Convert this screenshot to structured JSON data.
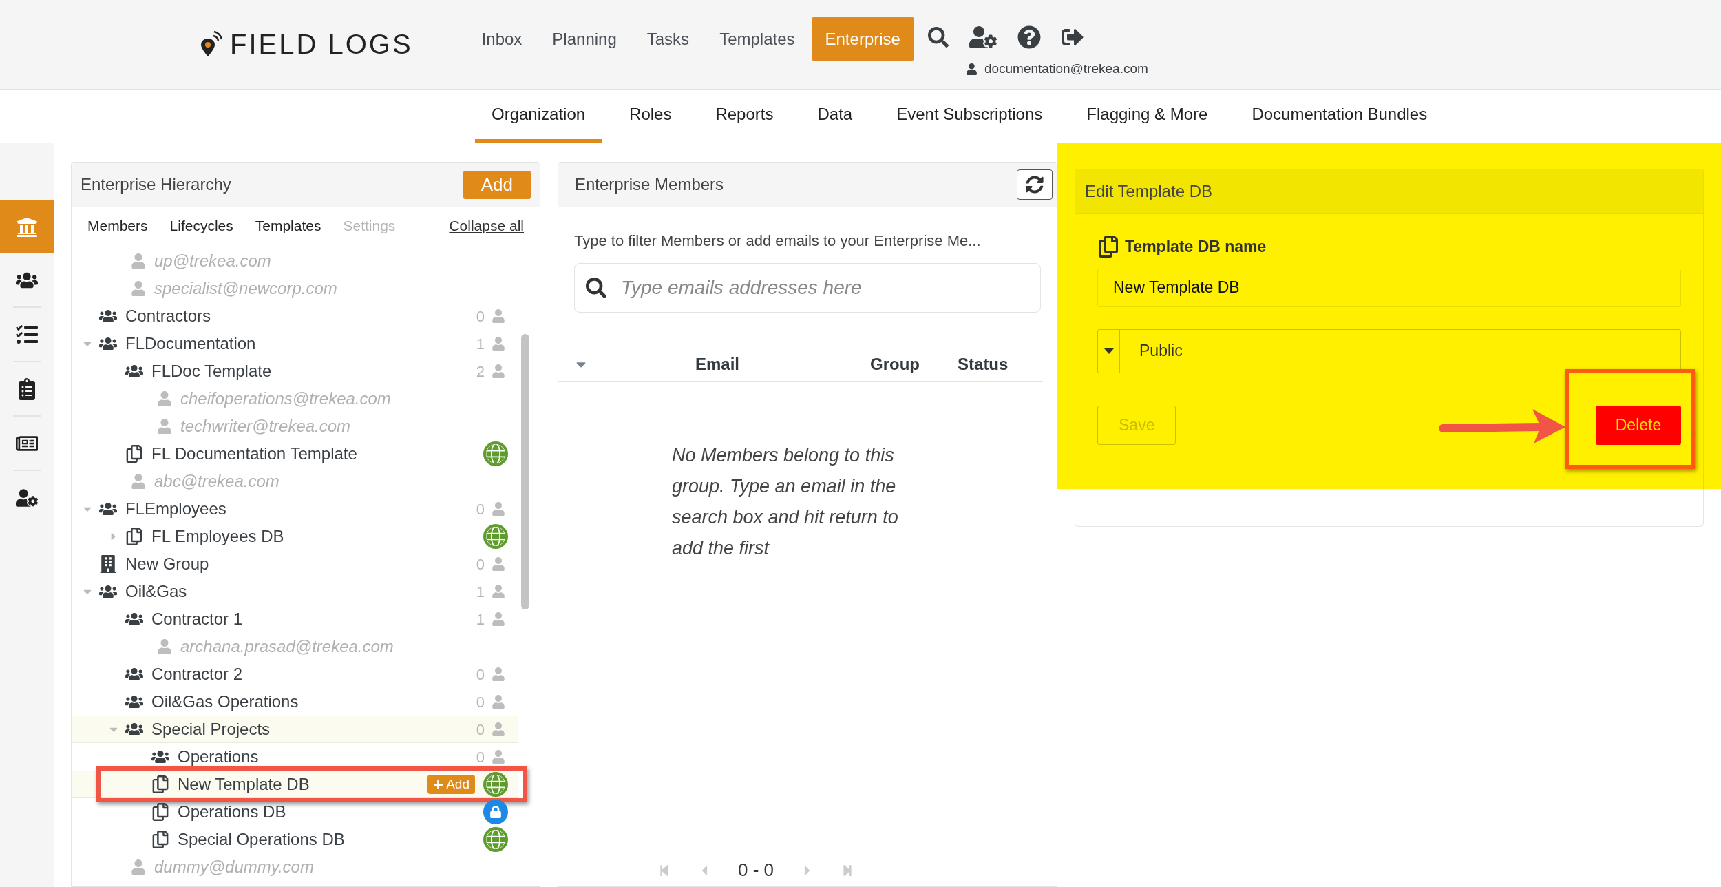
{
  "header": {
    "logo": "FIELD LOGS",
    "nav": [
      {
        "label": "Inbox",
        "selected": false
      },
      {
        "label": "Planning",
        "selected": false
      },
      {
        "label": "Tasks",
        "selected": false
      },
      {
        "label": "Templates",
        "selected": false
      },
      {
        "label": "Enterprise",
        "selected": true
      }
    ],
    "user": "documentation@trekea.com"
  },
  "subnav": [
    {
      "label": "Organization",
      "selected": true
    },
    {
      "label": "Roles",
      "selected": false
    },
    {
      "label": "Reports",
      "selected": false
    },
    {
      "label": "Data",
      "selected": false
    },
    {
      "label": "Event Subscriptions",
      "selected": false
    },
    {
      "label": "Flagging & More",
      "selected": false
    },
    {
      "label": "Documentation Bundles",
      "selected": false
    }
  ],
  "sidebar": [
    {
      "kind": "bank",
      "selected": true
    },
    {
      "kind": "users",
      "selected": false
    },
    {
      "kind": "tasks",
      "selected": false
    },
    {
      "kind": "clipboard",
      "selected": false
    },
    {
      "kind": "template",
      "selected": false
    },
    {
      "kind": "user-settings",
      "selected": false
    }
  ],
  "hierarchy": {
    "title": "Enterprise Hierarchy",
    "add": "Add",
    "tabs": [
      {
        "label": "Members",
        "disabled": false
      },
      {
        "label": "Lifecycles",
        "disabled": false
      },
      {
        "label": "Templates",
        "disabled": false
      },
      {
        "label": "Settings",
        "disabled": true
      }
    ],
    "collapse": "Collapse all",
    "continued_children": [
      {
        "kind": "member",
        "label": "up@trekea.com",
        "selected": false
      },
      {
        "kind": "member",
        "label": "specialist@newcorp.com",
        "selected": false
      }
    ],
    "nodes": [
      {
        "kind": "group",
        "label": "Contractors",
        "count": "0",
        "selected": false
      },
      {
        "kind": "group",
        "label": "FLDocumentation",
        "count": "1",
        "expanded": true,
        "selected": false,
        "children": [
          {
            "kind": "group",
            "label": "FLDoc Template",
            "count": "2",
            "selected": false,
            "children": [
              {
                "kind": "member",
                "label": "cheifoperations@trekea.com",
                "selected": false
              },
              {
                "kind": "member",
                "label": "techwriter@trekea.com",
                "selected": false
              }
            ]
          },
          {
            "kind": "template",
            "label": "FL Documentation Template",
            "public": true,
            "selected": false
          },
          {
            "kind": "member",
            "label": "abc@trekea.com",
            "selected": false
          }
        ]
      },
      {
        "kind": "group",
        "label": "FLEmployees",
        "count": "0",
        "expanded": true,
        "selected": false,
        "children": [
          {
            "kind": "template",
            "label": "FL Employees DB",
            "public": true,
            "expanded": false,
            "selected": false
          }
        ]
      },
      {
        "kind": "building",
        "label": "New Group",
        "count": "0",
        "selected": false
      },
      {
        "kind": "group",
        "label": "Oil&Gas",
        "count": "1",
        "expanded": true,
        "selected": false,
        "children": [
          {
            "kind": "group",
            "label": "Contractor 1",
            "count": "1",
            "selected": false,
            "children": [
              {
                "kind": "member",
                "label": "archana.prasad@trekea.com",
                "selected": false
              }
            ]
          },
          {
            "kind": "group",
            "label": "Contractor 2",
            "count": "0",
            "selected": false
          },
          {
            "kind": "group",
            "label": "Oil&Gas Operations",
            "count": "0",
            "selected": false
          },
          {
            "kind": "group",
            "label": "Special Projects",
            "count": "0",
            "expanded": true,
            "selected": true,
            "children": [
              {
                "kind": "group",
                "label": "Operations",
                "count": "0",
                "selected": false
              },
              {
                "kind": "template",
                "label": "New Template DB",
                "public": true,
                "add": "Add",
                "callout": true,
                "selected": true
              },
              {
                "kind": "template",
                "label": "Operations DB",
                "public": false,
                "selected": false
              },
              {
                "kind": "template",
                "label": "Special Operations DB",
                "public": true,
                "selected": false
              }
            ]
          },
          {
            "kind": "member",
            "label": "dummy@dummy.com",
            "selected": false
          }
        ]
      }
    ]
  },
  "members": {
    "title": "Enterprise Members",
    "hint": "Type to filter Members or add emails to your Enterprise Me...",
    "search": {
      "placeholder": "Type emails addresses here"
    },
    "columns": [
      "Email",
      "Group",
      "Status"
    ],
    "empty": "No Members belong to this group. Type an email in the search box and hit return to add the first",
    "range": "0 - 0"
  },
  "editor": {
    "title": "Edit Template DB",
    "name_label": "Template DB name",
    "name_value": "New Template DB",
    "visibility": "Public",
    "save": {
      "label": "Save",
      "disabled": true
    },
    "delete": {
      "label": "Delete",
      "callout": true
    }
  }
}
